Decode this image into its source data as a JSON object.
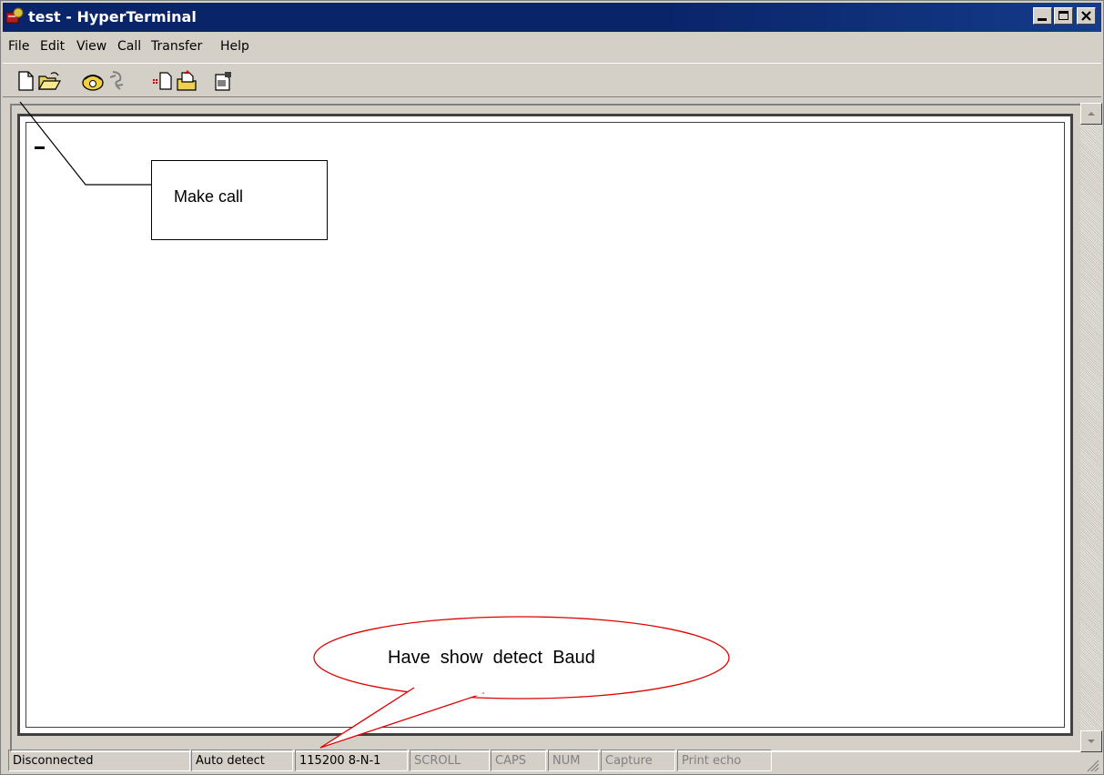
{
  "window": {
    "title": "test - HyperTerminal",
    "icon": "hyperterminal-app-icon"
  },
  "menubar": {
    "items": [
      "File",
      "Edit",
      "View",
      "Call",
      "Transfer",
      "Help"
    ]
  },
  "toolbar": {
    "buttons": [
      "new-icon",
      "open-icon",
      "call-icon",
      "disconnect-icon",
      "send-icon",
      "receive-icon",
      "properties-icon"
    ]
  },
  "terminal": {
    "cursor": "_"
  },
  "statusbar": {
    "connection": "Disconnected",
    "detect": "Auto detect",
    "settings": "115200 8-N-1",
    "scroll": "SCROLL",
    "caps": "CAPS",
    "num": "NUM",
    "capture": "Capture",
    "print_echo": "Print echo"
  },
  "annotations": {
    "callout_label": "Make call",
    "bubble_label": "Have  show  detect  Baud"
  },
  "colors": {
    "titlebar": "#0a246a",
    "bubble_outline": "#e00000"
  }
}
